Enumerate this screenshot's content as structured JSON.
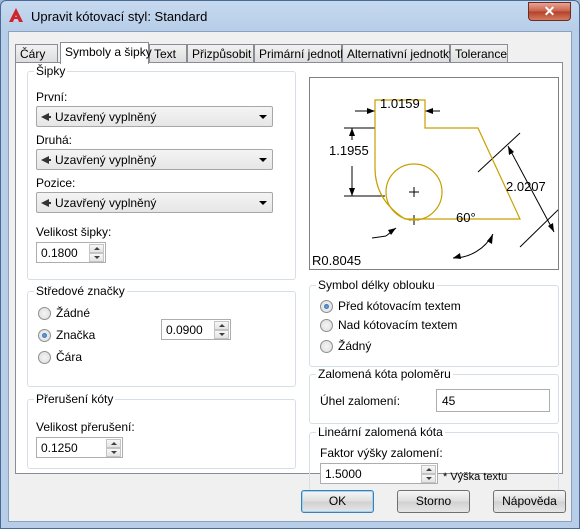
{
  "window": {
    "title": "Upravit kótovací styl: Standard",
    "close_glyph": "✕"
  },
  "tabs": [
    {
      "label": "Čáry"
    },
    {
      "label": "Symboly a šipky"
    },
    {
      "label": "Text"
    },
    {
      "label": "Přizpůsobit"
    },
    {
      "label": "Primární jednotky"
    },
    {
      "label": "Alternativní jednotky"
    },
    {
      "label": "Tolerance"
    }
  ],
  "arrows": {
    "group_label": "Šipky",
    "first_label": "První:",
    "first_value": "Uzavřený vyplněný",
    "second_label": "Druhá:",
    "second_value": "Uzavřený vyplněný",
    "leader_label": "Pozice:",
    "leader_value": "Uzavřený vyplněný",
    "size_label": "Velikost šipky:",
    "size_value": "0.1800"
  },
  "center_marks": {
    "group_label": "Středové značky",
    "options": [
      {
        "label": "Žádné",
        "checked": false
      },
      {
        "label": "Značka",
        "checked": true
      },
      {
        "label": "Čára",
        "checked": false
      }
    ],
    "size_value": "0.0900"
  },
  "dim_break": {
    "group_label": "Přerušení kóty",
    "size_label": "Velikost přerušení:",
    "size_value": "0.1250"
  },
  "preview": {
    "dim_top": "1.0159",
    "dim_left": "1.1955",
    "dim_right": "2.0207",
    "angle": "60°",
    "radius": "R0.8045",
    "outline_color": "#c8a000"
  },
  "arc_length": {
    "group_label": "Symbol délky oblouku",
    "options": [
      {
        "label": "Před kótovacím textem",
        "checked": true
      },
      {
        "label": "Nad kótovacím textem",
        "checked": false
      },
      {
        "label": "Žádný",
        "checked": false
      }
    ]
  },
  "radius_jog": {
    "group_label": "Zalomená kóta poloměru",
    "angle_label": "Úhel zalomení:",
    "angle_value": "45"
  },
  "linear_jog": {
    "group_label": "Lineární zalomená kóta",
    "factor_label": "Faktor výšky zalomení:",
    "factor_value": "1.5000",
    "factor_suffix": "* Výška textu"
  },
  "buttons": {
    "ok": "OK",
    "cancel": "Storno",
    "help": "Nápověda"
  }
}
